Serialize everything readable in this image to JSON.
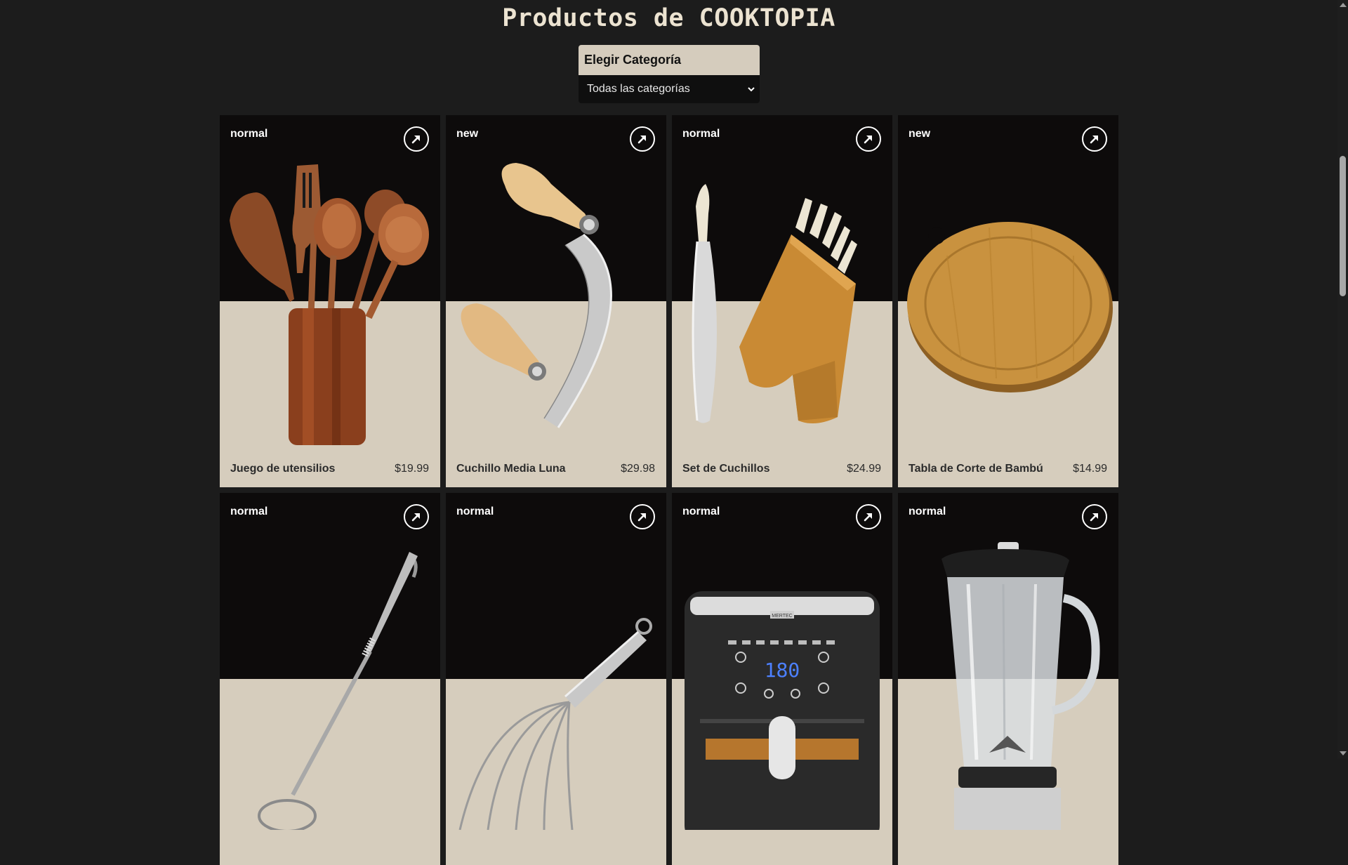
{
  "page": {
    "title": "Productos de COOKTOPIA"
  },
  "filter": {
    "label": "Elegir Categoría",
    "selected": "Todas las categorías"
  },
  "products": [
    {
      "badge": "normal",
      "name": "Juego de utensilios",
      "price": "$19.99",
      "image": "wooden-utensils-image"
    },
    {
      "badge": "new",
      "name": "Cuchillo Media Luna",
      "price": "$29.98",
      "image": "mezzaluna-knife-image"
    },
    {
      "badge": "normal",
      "name": "Set de Cuchillos",
      "price": "$24.99",
      "image": "knife-block-image"
    },
    {
      "badge": "new",
      "name": "Tabla de Corte de Bambú",
      "price": "$14.99",
      "image": "bamboo-board-image"
    },
    {
      "badge": "normal",
      "image": "skimmer-image"
    },
    {
      "badge": "normal",
      "image": "whisk-image"
    },
    {
      "badge": "normal",
      "image": "air-fryer-image",
      "display_reading": "180",
      "brand_text": "MERTEC"
    },
    {
      "badge": "normal",
      "image": "blender-image"
    }
  ],
  "colors": {
    "background": "#1c1c1c",
    "card_top": "#0d0b0b",
    "card_bottom": "#d6cdbd",
    "label_bg": "#d5ccbd",
    "title": "#ece3d1"
  }
}
